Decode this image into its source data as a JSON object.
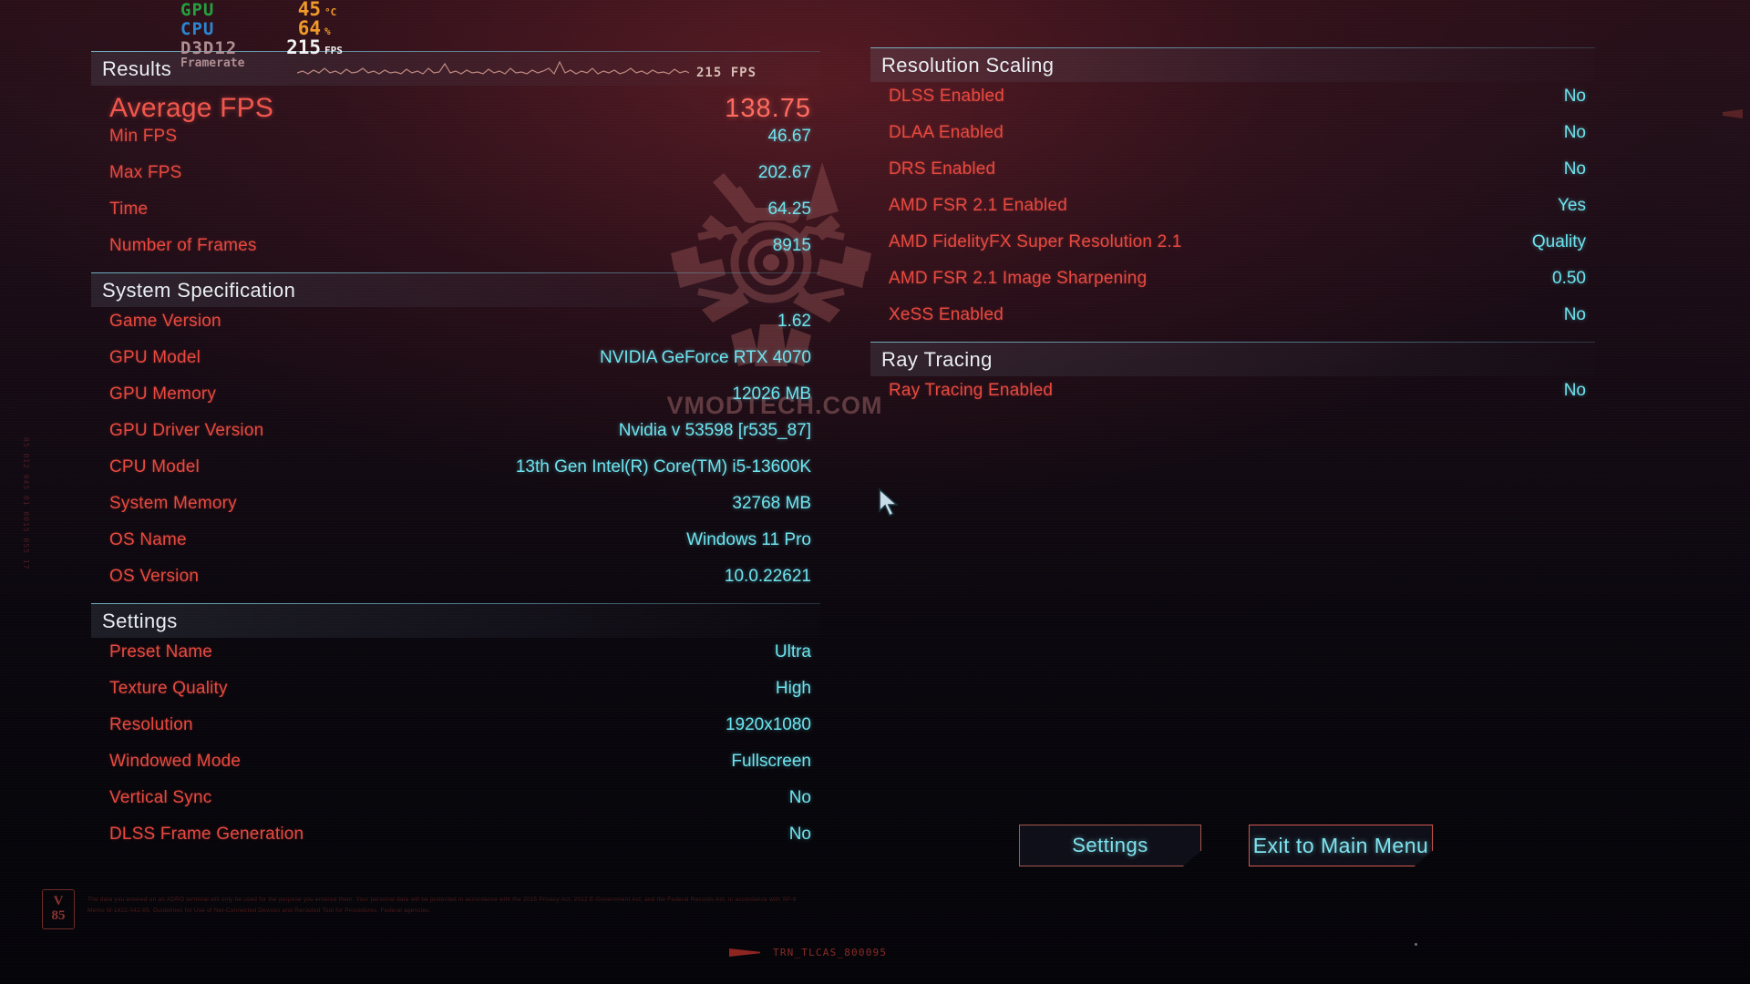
{
  "osd": {
    "gpu": {
      "label": "GPU",
      "value": "45",
      "unit": "°C"
    },
    "cpu": {
      "label": "CPU",
      "value": "64",
      "unit": "%"
    },
    "api": {
      "label": "D3D12",
      "value": "215",
      "unit": "FPS"
    },
    "graph": {
      "label": "Framerate",
      "value": "215 FPS"
    }
  },
  "watermark": "VMODTECH.COM",
  "sections": {
    "results": {
      "title": "Results",
      "hero": {
        "label": "Average FPS",
        "value": "138.75"
      },
      "rows": [
        {
          "label": "Min FPS",
          "value": "46.67"
        },
        {
          "label": "Max FPS",
          "value": "202.67"
        },
        {
          "label": "Time",
          "value": "64.25"
        },
        {
          "label": "Number of Frames",
          "value": "8915"
        }
      ]
    },
    "system_specification": {
      "title": "System Specification",
      "rows": [
        {
          "label": "Game Version",
          "value": "1.62"
        },
        {
          "label": "GPU Model",
          "value": "NVIDIA GeForce RTX 4070"
        },
        {
          "label": "GPU Memory",
          "value": "12026 MB"
        },
        {
          "label": "GPU Driver Version",
          "value": "Nvidia v 53598 [r535_87]"
        },
        {
          "label": "CPU Model",
          "value": "13th Gen Intel(R) Core(TM) i5-13600K"
        },
        {
          "label": "System Memory",
          "value": "32768 MB"
        },
        {
          "label": "OS Name",
          "value": "Windows 11 Pro"
        },
        {
          "label": "OS Version",
          "value": "10.0.22621"
        }
      ]
    },
    "settings": {
      "title": "Settings",
      "rows": [
        {
          "label": "Preset Name",
          "value": "Ultra"
        },
        {
          "label": "Texture Quality",
          "value": "High"
        },
        {
          "label": "Resolution",
          "value": "1920x1080"
        },
        {
          "label": "Windowed Mode",
          "value": "Fullscreen"
        },
        {
          "label": "Vertical Sync",
          "value": "No"
        },
        {
          "label": "DLSS Frame Generation",
          "value": "No"
        }
      ]
    },
    "resolution_scaling": {
      "title": "Resolution Scaling",
      "rows": [
        {
          "label": "DLSS Enabled",
          "value": "No"
        },
        {
          "label": "DLAA Enabled",
          "value": "No"
        },
        {
          "label": "DRS Enabled",
          "value": "No"
        },
        {
          "label": "AMD FSR 2.1 Enabled",
          "value": "Yes"
        },
        {
          "label": "AMD FidelityFX Super Resolution 2.1",
          "value": "Quality"
        },
        {
          "label": "AMD FSR 2.1 Image Sharpening",
          "value": "0.50"
        },
        {
          "label": "XeSS Enabled",
          "value": "No"
        }
      ]
    },
    "ray_tracing": {
      "title": "Ray Tracing",
      "rows": [
        {
          "label": "Ray Tracing Enabled",
          "value": "No"
        }
      ]
    }
  },
  "buttons": {
    "settings": "Settings",
    "exit": "Exit to Main Menu"
  },
  "footer": {
    "badge_top": "V",
    "badge_bottom": "85",
    "legal": "The data you entered on an ADRO terminal will only be used for the purpose you entered them. Your personal data will be protected in accordance with the 2015 Privacy Act, 2012 E-Government Act, and the Federal Records Act, in accordance with SP-8 Memo M-1822-042-85, Guidelines for Use of Net-Connected Devices and Rerouted Tool for Procedures, Federal agencies.",
    "build_tag": "TRN_TLCAS_800095"
  },
  "side_glyph": "05 012 045 01 0015 055 17",
  "colors": {
    "label": "#e8493f",
    "value": "#6de4ef",
    "hero": "#ff6a5e",
    "rule": "#7ec8d8",
    "button_border": "#c0564c",
    "button_text": "#7fe3ef"
  }
}
